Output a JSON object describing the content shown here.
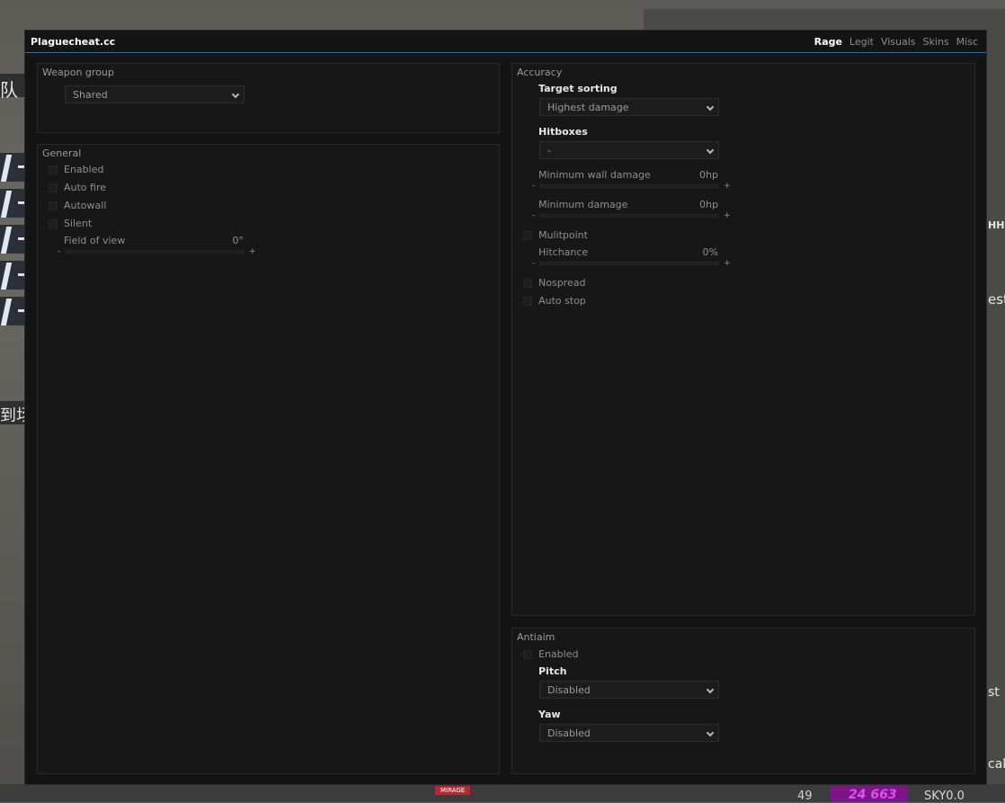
{
  "app": {
    "title": "Plaguecheat.cc"
  },
  "tabs": [
    {
      "label": "Rage",
      "active": true
    },
    {
      "label": "Legit",
      "active": false
    },
    {
      "label": "Visuals",
      "active": false
    },
    {
      "label": "Skins",
      "active": false
    },
    {
      "label": "Misc",
      "active": false
    }
  ],
  "weapon_group": {
    "title": "Weapon group",
    "selected": "Shared"
  },
  "general": {
    "title": "General",
    "checkboxes": [
      "Enabled",
      "Auto fire",
      "Autowall",
      "Silent"
    ],
    "fov": {
      "label": "Field of view",
      "value": "0°",
      "minus": "-",
      "plus": "+"
    }
  },
  "accuracy": {
    "title": "Accuracy",
    "target_sorting": {
      "label": "Target sorting",
      "selected": "Highest damage"
    },
    "hitboxes": {
      "label": "Hitboxes",
      "selected": "-"
    },
    "min_wall_damage": {
      "label": "Minimum wall damage",
      "value": "0hp",
      "minus": "-",
      "plus": "+"
    },
    "min_damage": {
      "label": "Minimum damage",
      "value": "0hp",
      "minus": "-",
      "plus": "+"
    },
    "multipoint": {
      "label": "Mulitpoint"
    },
    "hitchance": {
      "label": "Hitchance",
      "value": "0%",
      "minus": "-",
      "plus": "+"
    },
    "nospread": {
      "label": "Nospread"
    },
    "auto_stop": {
      "label": "Auto stop"
    }
  },
  "antiaim": {
    "title": "Antiaim",
    "enabled": {
      "label": "Enabled"
    },
    "pitch": {
      "label": "Pitch",
      "selected": "Disabled"
    },
    "yaw": {
      "label": "Yaw",
      "selected": "Disabled"
    }
  },
  "background": {
    "left_text_1": "队",
    "left_text_2": "到场",
    "right_text_1": "HHI",
    "right_text_2": "est",
    "right_text_3": "st",
    "right_text_4": "call",
    "bottom_num_1": "49",
    "bottom_num_2": "24 663",
    "bottom_name": "SKY0.0",
    "map_badge": "MIRAGE"
  },
  "colors": {
    "accent": "#3e6a9a",
    "window_bg": "#141414",
    "panel_bg": "#171717"
  }
}
